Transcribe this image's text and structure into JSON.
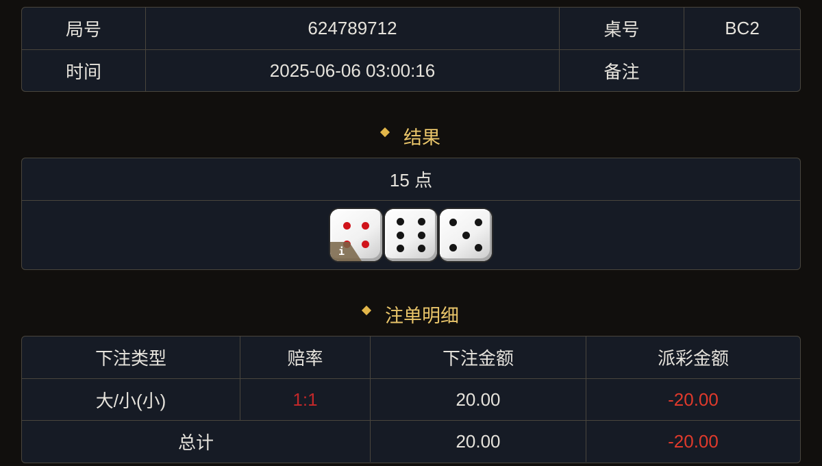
{
  "info": {
    "round_label": "局号",
    "round_value": "624789712",
    "table_label": "桌号",
    "table_value": "BC2",
    "time_label": "时间",
    "time_value": "2025-06-06 03:00:16",
    "note_label": "备注",
    "note_value": ""
  },
  "result": {
    "title": "结果",
    "points": "15 点",
    "dice": [
      4,
      6,
      5
    ],
    "info_badge": "i"
  },
  "bets": {
    "title": "注单明细",
    "headers": [
      "下注类型",
      "赔率",
      "下注金额",
      "派彩金额"
    ],
    "rows": [
      {
        "type": "大/小(小)",
        "odds": "1:1",
        "amount": "20.00",
        "payout": "-20.00"
      }
    ],
    "total": {
      "label": "总计",
      "amount": "20.00",
      "payout": "-20.00"
    }
  },
  "colors": {
    "accent": "#e9c56a",
    "negative": "#e03a2c",
    "panel_bg": "#161b25",
    "border": "#4a463d"
  }
}
